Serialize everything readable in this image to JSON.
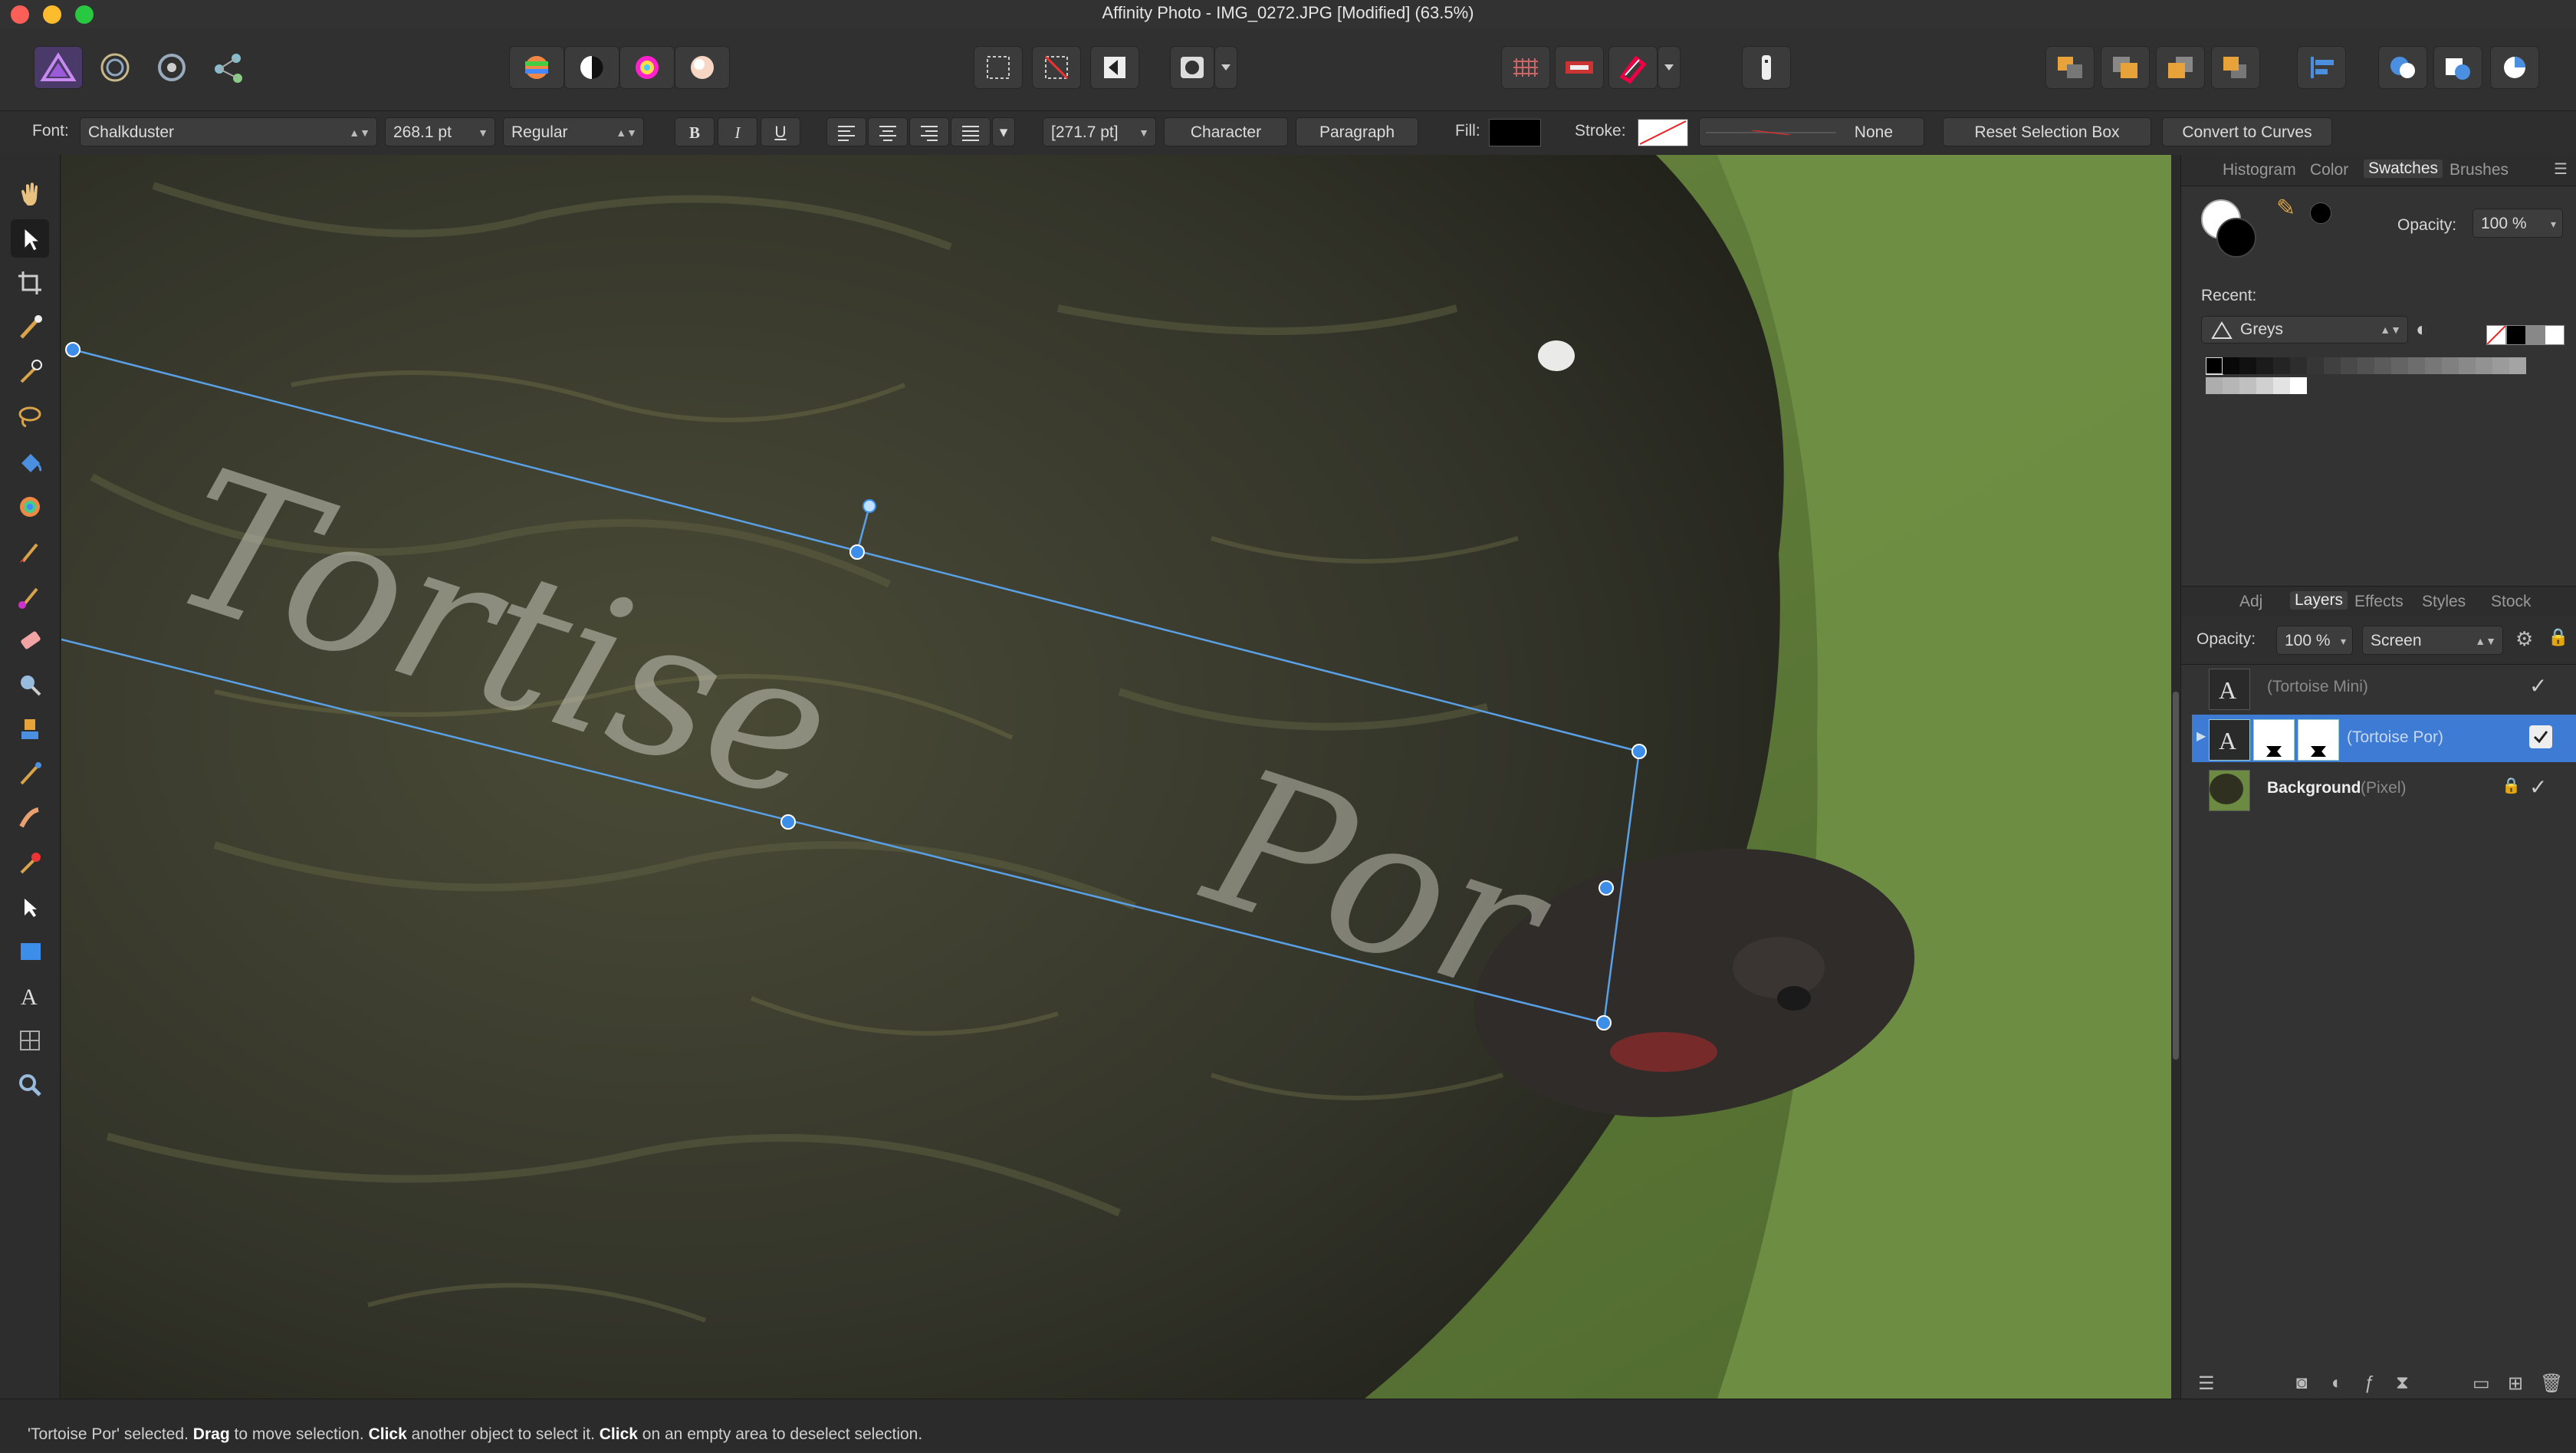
{
  "window": {
    "title": "Affinity Photo - IMG_0272.JPG [Modified] (63.5%)"
  },
  "colors": {
    "accent": "#3d7bd4",
    "selection_line": "#5aa0e6",
    "traffic_close": "#fc5f57",
    "traffic_min": "#fdbc2e",
    "traffic_max": "#28c840",
    "layer_selected_bg": "#3d7bd4"
  },
  "toolbar": {
    "persona_icons": [
      "photo-persona-icon",
      "liquify-persona-icon",
      "develop-persona-icon",
      "export-persona-icon"
    ],
    "adjust_icons": [
      "auto-levels-icon",
      "auto-contrast-icon",
      "auto-colors-icon",
      "auto-white-balance-icon"
    ],
    "selection_icons": [
      "marquee-select-icon",
      "deselect-icon",
      "invert-selection-icon"
    ],
    "mask_icons": [
      "quick-mask-icon",
      "mask-dropdown-icon"
    ],
    "snap_icons": [
      "grid-icon",
      "assistant-icon",
      "snapping-icon",
      "snapping-dropdown-icon",
      "info-icon"
    ],
    "arrange_icons": [
      "move-to-back-icon",
      "move-back-icon",
      "move-forward-icon",
      "move-to-front-icon",
      "align-icon",
      "add-icon",
      "subtract-icon",
      "intersect-icon"
    ]
  },
  "context": {
    "font_label": "Font:",
    "font_value": "Chalkduster",
    "size_value": "268.1 pt",
    "style_value": "Regular",
    "bold": "B",
    "italic": "I",
    "underline": "U",
    "leading_value": "[271.7 pt]",
    "character_btn": "Character",
    "paragraph_btn": "Paragraph",
    "fill_label": "Fill:",
    "fill_color": "#000000",
    "stroke_label": "Stroke:",
    "stroke_value": "None",
    "reset_btn": "Reset Selection Box",
    "convert_btn": "Convert to Curves"
  },
  "tools": [
    "view-tool-icon",
    "move-tool-icon",
    "crop-tool-icon",
    "selection-brush-icon",
    "flood-select-icon",
    "freehand-select-icon",
    "flood-fill-icon",
    "gradient-tool-icon",
    "paint-brush-icon",
    "color-replacement-icon",
    "erase-brush-icon",
    "dodge-brush-icon",
    "clone-brush-icon",
    "blemish-removal-icon",
    "smudge-brush-icon",
    "red-eye-icon",
    "node-tool-icon",
    "rectangle-tool-icon",
    "text-tool-icon",
    "mesh-warp-icon",
    "zoom-tool-icon"
  ],
  "swatches_panel": {
    "tabs": [
      "Histogram",
      "Color",
      "Swatches",
      "Brushes"
    ],
    "active_tab": "Swatches",
    "opacity_label": "Opacity:",
    "opacity_value": "100 %",
    "recent_label": "Recent:",
    "palette_value": "Greys"
  },
  "layers_panel": {
    "tabs": [
      "Adj",
      "Layers",
      "Effects",
      "Styles",
      "Stock"
    ],
    "active_tab": "Layers",
    "opacity_label": "Opacity:",
    "opacity_value": "100 %",
    "blend_value": "Screen",
    "layers": [
      {
        "name": "(Tortoise  Mini)",
        "type": "text",
        "selected": false,
        "visible": true
      },
      {
        "name": "(Tortoise  Por)",
        "type": "text",
        "selected": true,
        "visible": true
      },
      {
        "name": "Background",
        "kind": "(Pixel)",
        "type": "pixel",
        "selected": false,
        "visible": true,
        "locked": true
      }
    ]
  },
  "canvas": {
    "overlay_text_1": "Tortise",
    "overlay_text_2": "Por"
  },
  "status": {
    "prefix": "'Tortoise  Por' selected. ",
    "b1": "Drag",
    "t1": " to move selection. ",
    "b2": "Click",
    "t2": " another object to select it. ",
    "b3": "Click",
    "t3": " on an empty area to deselect selection."
  }
}
